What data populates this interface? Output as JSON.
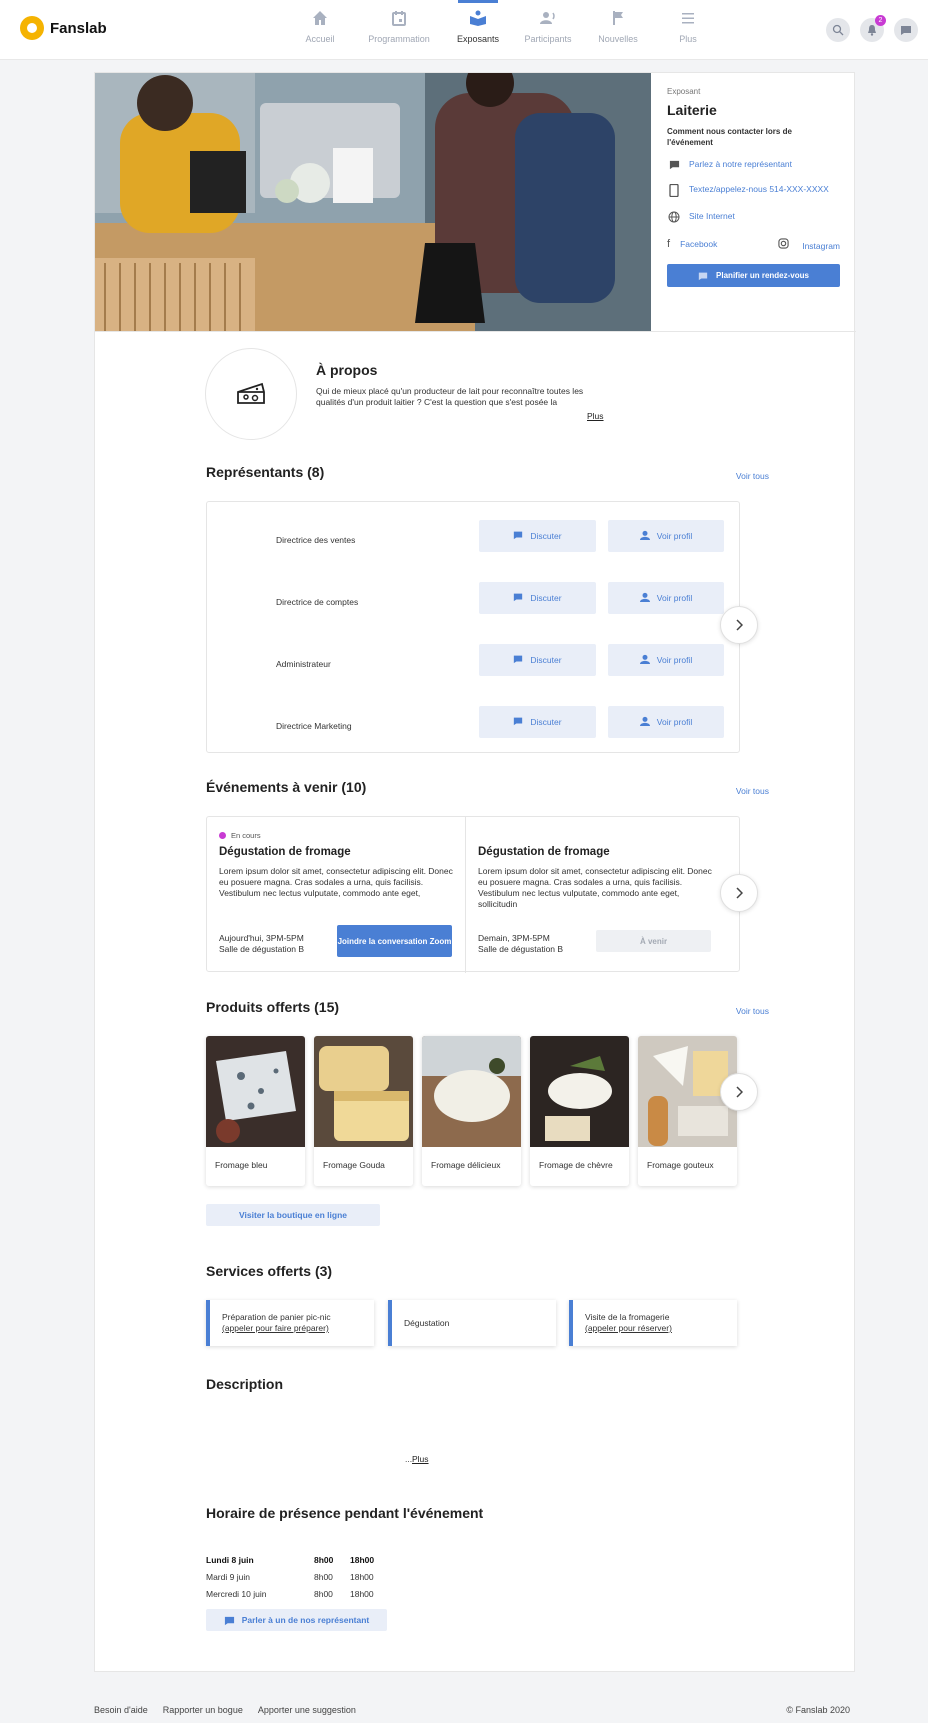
{
  "app": {
    "name": "Fanslab"
  },
  "nav": {
    "items": [
      {
        "label": "Accueil",
        "icon": "home-icon"
      },
      {
        "label": "Programmation",
        "icon": "calendar-icon"
      },
      {
        "label": "Exposants",
        "icon": "exhibitor-icon",
        "active": true
      },
      {
        "label": "Participants",
        "icon": "participants-icon"
      },
      {
        "label": "Nouvelles",
        "icon": "flag-icon"
      },
      {
        "label": "Plus",
        "icon": "menu-icon"
      }
    ],
    "notification_count": "2"
  },
  "exhibitor": {
    "kind": "Exposant",
    "name": "Laiterie",
    "contact_heading": "Comment nous contacter lors de l'événement",
    "talk_rep": "Parlez à notre représentant",
    "text_call": "Textez/appelez-nous 514-XXX-XXXX",
    "website": "Site Internet",
    "facebook": "Facebook",
    "instagram": "Instagram",
    "schedule_button": "Planifier un rendez-vous"
  },
  "about": {
    "title": "À propos",
    "text": "Qui de mieux placé qu'un producteur de lait pour reconnaître toutes les qualités d'un produit laitier ? C'est la question que s'est posée la",
    "more": "Plus"
  },
  "representatives": {
    "title": "Représentants (8)",
    "see_all": "Voir tous",
    "chat_label": "Discuter",
    "profile_label": "Voir profil",
    "items": [
      {
        "role": "Directrice des ventes"
      },
      {
        "role": "Directrice de comptes"
      },
      {
        "role": "Administrateur"
      },
      {
        "role": "Directrice Marketing"
      }
    ]
  },
  "events": {
    "title": "Événements à venir (10)",
    "see_all": "Voir tous",
    "items": [
      {
        "status": "En cours",
        "title": "Dégustation de fromage",
        "desc": "Lorem ipsum dolor sit amet, consectetur adipiscing elit. Donec eu posuere magna. Cras sodales a urna, quis facilisis. Vestibulum nec lectus vulputate, commodo ante eget,",
        "when": "Aujourd'hui, 3PM-5PM",
        "where": "Salle de dégustation B",
        "button": "Joindre la conversation Zoom"
      },
      {
        "status": "",
        "title": "Dégustation de fromage",
        "desc": "Lorem ipsum dolor sit amet, consectetur adipiscing elit. Donec eu posuere magna. Cras sodales a urna, quis facilisis. Vestibulum nec lectus vulputate, commodo ante eget, sollicitudin",
        "when": "Demain, 3PM-5PM",
        "where": "Salle de dégustation B",
        "button": "À venir"
      }
    ]
  },
  "products": {
    "title": "Produits offerts (15)",
    "see_all": "Voir tous",
    "items": [
      {
        "name": "Fromage bleu"
      },
      {
        "name": "Fromage Gouda"
      },
      {
        "name": "Fromage délicieux"
      },
      {
        "name": "Fromage de chèvre"
      },
      {
        "name": "Fromage gouteux"
      }
    ],
    "shop_button": "Visiter la boutique en ligne"
  },
  "services": {
    "title": "Services offerts (3)",
    "items": [
      {
        "name": "Préparation de panier pic-nic",
        "link": "(appeler pour faire préparer)"
      },
      {
        "name": "Dégustation",
        "link": ""
      },
      {
        "name": "Visite de la fromagerie",
        "link": "(appeler pour réserver)"
      }
    ]
  },
  "description": {
    "title": "Description",
    "more": "Plus"
  },
  "schedule": {
    "title": "Horaire de présence pendant l'événement",
    "rows": [
      {
        "day": "Lundi 8 juin",
        "start": "8h00",
        "end": "18h00"
      },
      {
        "day": "Mardi 9 juin",
        "start": "8h00",
        "end": "18h00"
      },
      {
        "day": "Mercredi 10 juin",
        "start": "8h00",
        "end": "18h00"
      }
    ],
    "contact_button": "Parler à un de nos représentant"
  },
  "footer": {
    "help": "Besoin d'aide",
    "bug": "Rapporter un bogue",
    "suggest": "Apporter une suggestion",
    "copyright": "© Fanslab 2020"
  },
  "colors": {
    "accent": "#4a7fd4",
    "badge": "#c83bd3",
    "brand": "#f5b301"
  }
}
